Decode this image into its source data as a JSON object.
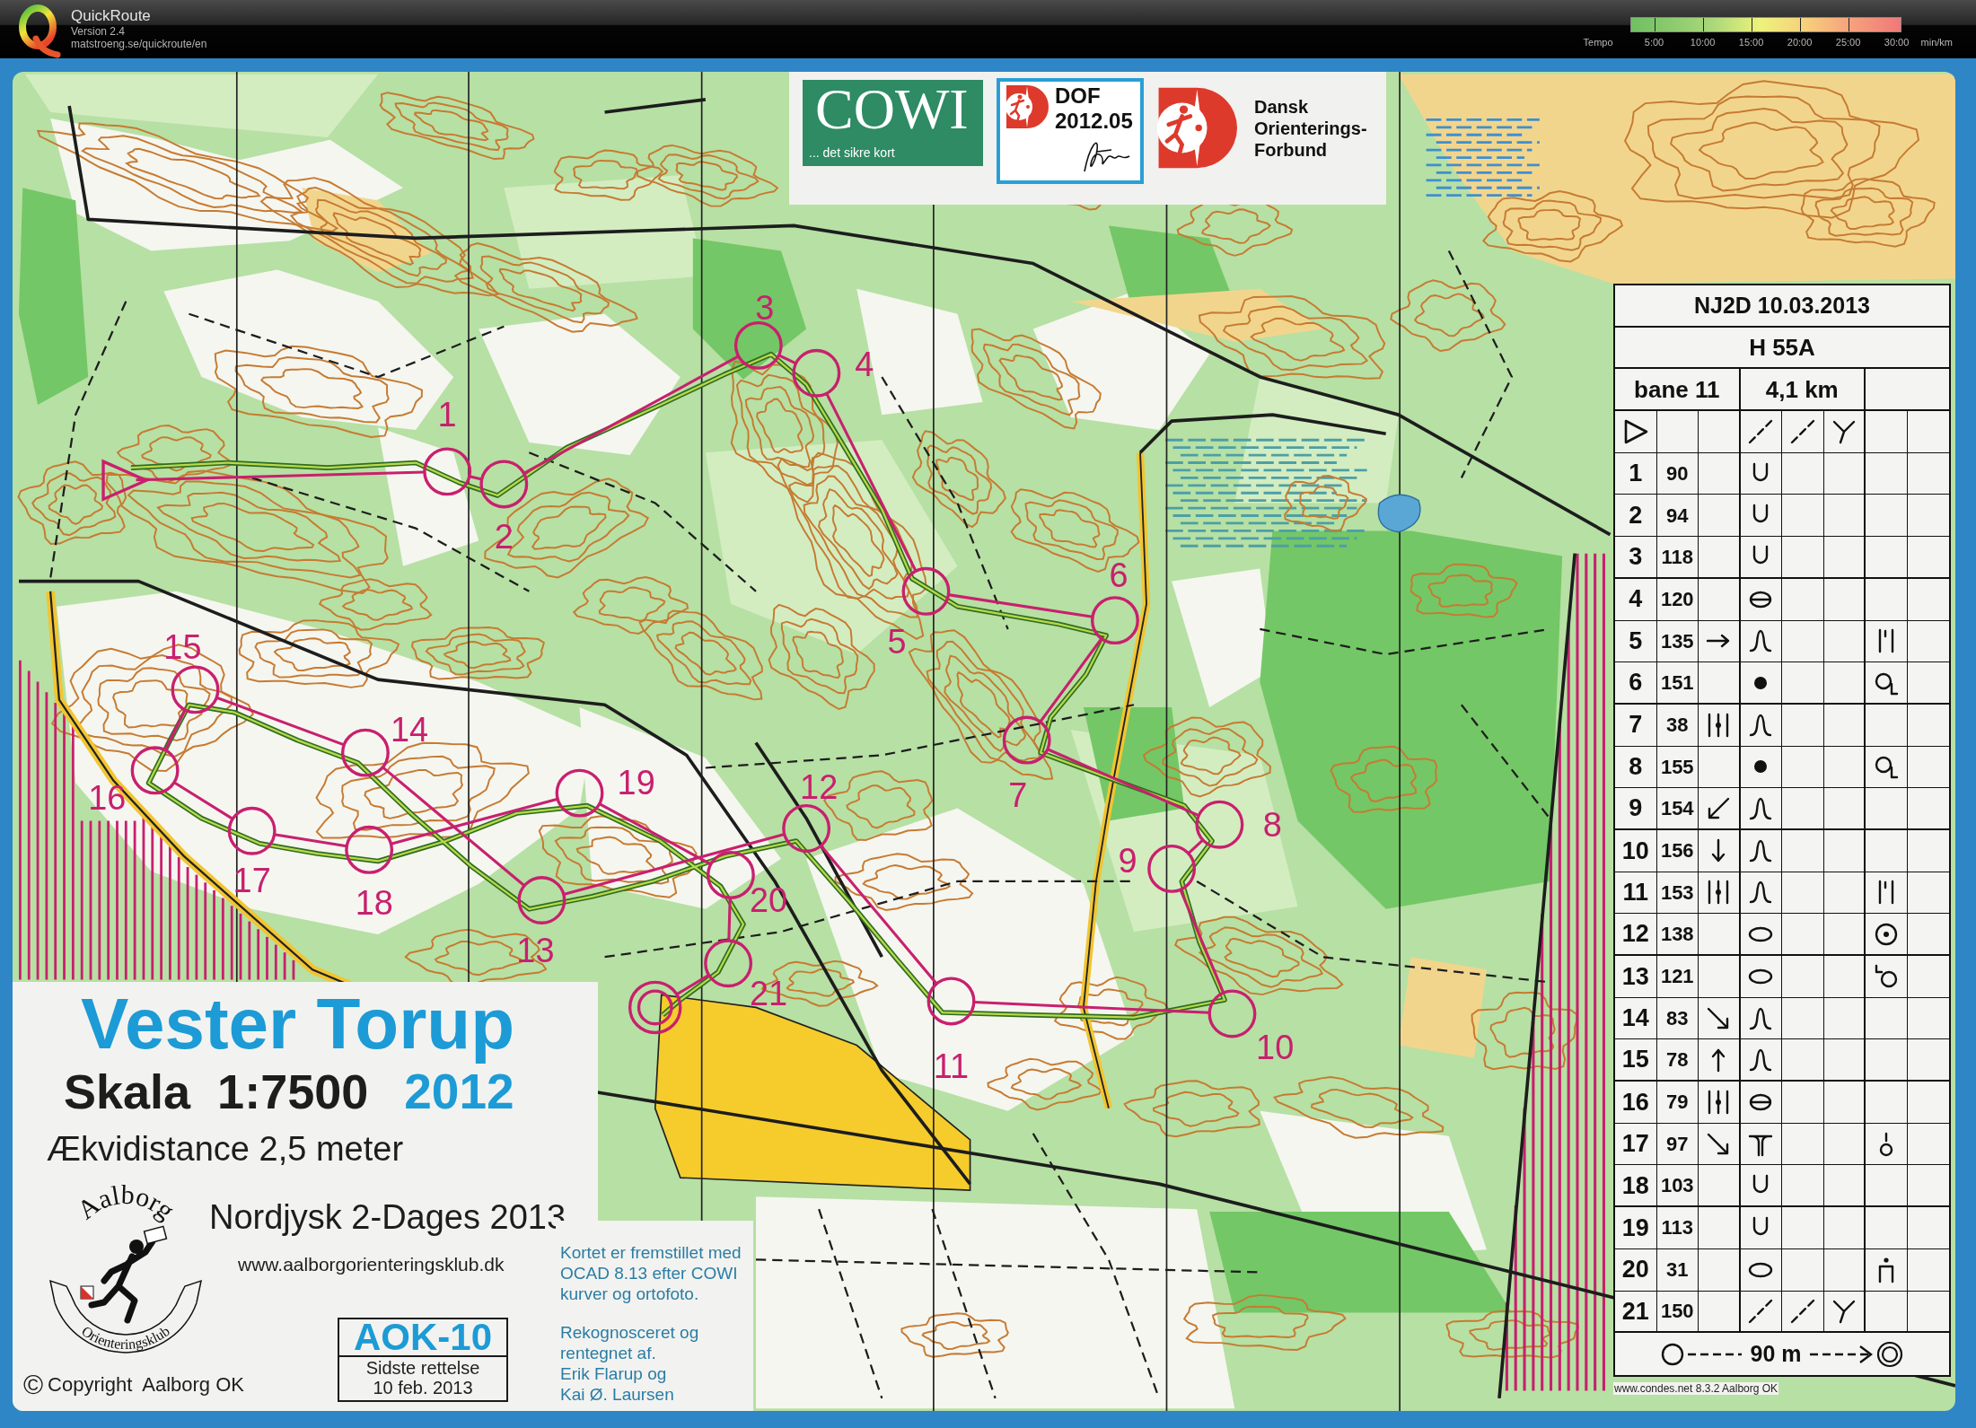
{
  "app_bar": {
    "title": "QuickRoute",
    "version": "Version 2.4",
    "url": "matstroeng.se/quickroute/en",
    "tempo_scale": {
      "label": "Tempo",
      "ticks": [
        "5:00",
        "10:00",
        "15:00",
        "20:00",
        "25:00",
        "30:00"
      ],
      "unit": "min/km"
    }
  },
  "sponsor_strip": {
    "cowi_logo": {
      "name": "COWI",
      "tagline": "... det sikre kort"
    },
    "approval_stamp": [
      "DOF",
      "2012.05"
    ],
    "federation": [
      "Dansk",
      "Orienterings-",
      "Forbund"
    ]
  },
  "course": {
    "controls": [
      {
        "label": "1"
      },
      {
        "label": "2"
      },
      {
        "label": "3"
      },
      {
        "label": "4"
      },
      {
        "label": "5"
      },
      {
        "label": "6"
      },
      {
        "label": "7"
      },
      {
        "label": "8"
      },
      {
        "label": "9"
      },
      {
        "label": "10"
      },
      {
        "label": "11"
      },
      {
        "label": "12"
      },
      {
        "label": "13"
      },
      {
        "label": "14"
      },
      {
        "label": "15"
      },
      {
        "label": "16"
      },
      {
        "label": "17"
      },
      {
        "label": "18"
      },
      {
        "label": "19"
      },
      {
        "label": "20"
      },
      {
        "label": "21"
      }
    ]
  },
  "control_descriptions": {
    "event": "NJ2D 10.03.2013",
    "class": "H 55A",
    "course": "bane 11",
    "length": "4,1 km",
    "start": {
      "column_4": {
        "kind": "dashes"
      },
      "column_5": {
        "kind": "dashes"
      },
      "column_6": {
        "kind": "junction"
      }
    },
    "rows": [
      {
        "number": "1",
        "code": "90",
        "column_4": {
          "kind": "cup"
        }
      },
      {
        "number": "2",
        "code": "94",
        "column_4": {
          "kind": "cup"
        }
      },
      {
        "number": "3",
        "code": "118",
        "column_4": {
          "kind": "cup"
        }
      },
      {
        "number": "4",
        "code": "120",
        "column_4": {
          "kind": "crossed"
        }
      },
      {
        "number": "5",
        "code": "135",
        "column_3": {
          "kind": "east"
        },
        "column_4": {
          "kind": "arch"
        },
        "column_7": {
          "kind": "posts"
        }
      },
      {
        "number": "6",
        "code": "151",
        "column_4": {
          "kind": "dot"
        },
        "column_7": {
          "kind": "ringtag"
        }
      },
      {
        "number": "7",
        "code": "38",
        "column_3": {
          "kind": "between"
        },
        "column_4": {
          "kind": "arch"
        }
      },
      {
        "number": "8",
        "code": "155",
        "column_4": {
          "kind": "dot"
        },
        "column_7": {
          "kind": "ringtag"
        }
      },
      {
        "number": "9",
        "code": "154",
        "column_3": {
          "kind": "southwest"
        },
        "column_4": {
          "kind": "arch"
        }
      },
      {
        "number": "10",
        "code": "156",
        "column_3": {
          "kind": "south"
        },
        "column_4": {
          "kind": "arch"
        }
      },
      {
        "number": "11",
        "code": "153",
        "column_3": {
          "kind": "between"
        },
        "column_4": {
          "kind": "arch"
        },
        "column_7": {
          "kind": "posts"
        }
      },
      {
        "number": "12",
        "code": "138",
        "column_4": {
          "kind": "ellipse"
        },
        "column_7": {
          "kind": "target"
        }
      },
      {
        "number": "13",
        "code": "121",
        "column_4": {
          "kind": "ellipse"
        },
        "column_7": {
          "kind": "cornerring"
        }
      },
      {
        "number": "14",
        "code": "83",
        "column_3": {
          "kind": "southeast"
        },
        "column_4": {
          "kind": "arch"
        }
      },
      {
        "number": "15",
        "code": "78",
        "column_3": {
          "kind": "north"
        },
        "column_4": {
          "kind": "arch"
        }
      },
      {
        "number": "16",
        "code": "79",
        "column_3": {
          "kind": "between"
        },
        "column_4": {
          "kind": "crossed"
        }
      },
      {
        "number": "17",
        "code": "97",
        "column_3": {
          "kind": "southeast"
        },
        "column_4": {
          "kind": "fork"
        },
        "column_7": {
          "kind": "topring"
        }
      },
      {
        "number": "18",
        "code": "103",
        "column_4": {
          "kind": "cup"
        }
      },
      {
        "number": "19",
        "code": "113",
        "column_4": {
          "kind": "cup"
        }
      },
      {
        "number": "20",
        "code": "31",
        "column_4": {
          "kind": "ellipse"
        },
        "column_7": {
          "kind": "gate"
        }
      },
      {
        "number": "21",
        "code": "150",
        "column_4": {
          "kind": "dashes"
        },
        "column_5": {
          "kind": "dashes"
        },
        "column_6": {
          "kind": "junction"
        }
      }
    ],
    "finish": "90 m"
  },
  "legend": {
    "title": "Vester Torup",
    "scale": "Skala  1:7500",
    "year": "2012",
    "contour_interval": "Ækvidistance 2,5 meter",
    "event": "Nordjysk 2-Dages 2013",
    "website": "www.aalborgorienteringsklub.dk",
    "club_logo": {
      "top_text": "Aalborg",
      "bottom_text": "Orienteringsklub"
    },
    "map_id": "AOK-10",
    "revision": [
      "Sidste rettelse",
      "10 feb. 2013"
    ],
    "copyright_sign": "©",
    "copyright": "Copyright  Aalborg OK"
  },
  "credits": [
    [
      "Kortet er fremstillet med",
      "OCAD 8.13 efter COWI",
      "kurver og ortofoto."
    ],
    [
      "Rekognosceret og",
      "rentegnet af.",
      "Erik Flarup og",
      "Kai Ø. Laursen"
    ]
  ],
  "footer_note": "www.condes.net 8.3.2 Aalborg OK"
}
